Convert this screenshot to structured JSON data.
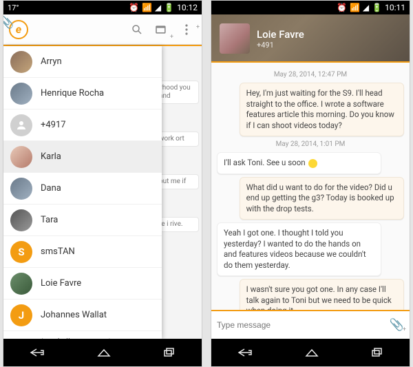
{
  "status": {
    "temp": "17°",
    "time_left": "10:12",
    "time_right": "10:11"
  },
  "appbar": {
    "search": "Search",
    "compose": "New message",
    "menu": "Menu"
  },
  "contacts": [
    {
      "name": "Arryn"
    },
    {
      "name": "Henrique Rocha"
    },
    {
      "name": "+4917"
    },
    {
      "name": "Karla",
      "selected": true
    },
    {
      "name": "Dana"
    },
    {
      "name": "Tara"
    },
    {
      "name": "smsTAN",
      "letter": "S",
      "orange": true
    },
    {
      "name": "Loie Favre"
    },
    {
      "name": "Johannes Wallat",
      "letter": "J",
      "orange": true
    }
  ],
  "load_more": "Load all conversations",
  "bg_snippets": [
    "yhood you and",
    "work ort",
    "but me if",
    "re i rive."
  ],
  "conversation": {
    "title": "Loie Favre",
    "subtitle": "+491",
    "thread": [
      {
        "type": "time",
        "text": "May 28, 2014, 12:47 PM"
      },
      {
        "type": "out",
        "text": "Hey, I'm just waiting for the S9. I'll head straight to the office. I wrote a software features article this morning. Do you know if I can shoot videos today?"
      },
      {
        "type": "time",
        "text": "May 28, 2014, 1:01 PM"
      },
      {
        "type": "in",
        "text": "I'll ask Toni. See u soon",
        "emoji": true
      },
      {
        "type": "out",
        "text": "What did u want to do for the video? Did u end up getting the g3? Today is booked up with the drop tests."
      },
      {
        "type": "in",
        "text": "Yeah I got one. I thought I told you yesterday? I wanted to do the hands on and features videos because we couldn't do them yesterday."
      },
      {
        "type": "out",
        "text": "I wasn't sure you got one. In any case I'll talk again to Toni but we need to be quick when doing it."
      }
    ],
    "composer_placeholder": "Type message"
  }
}
